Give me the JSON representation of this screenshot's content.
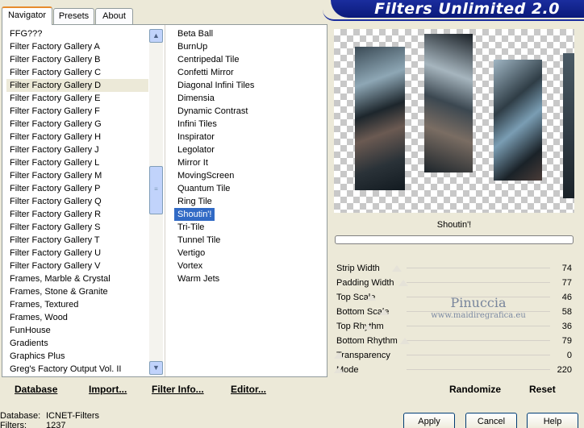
{
  "app": {
    "title": "Filters Unlimited 2.0"
  },
  "tabs": [
    {
      "label": "Navigator",
      "active": true
    },
    {
      "label": "Presets",
      "active": false
    },
    {
      "label": "About",
      "active": false
    }
  ],
  "categories": [
    "FFG???",
    "Filter Factory Gallery A",
    "Filter Factory Gallery B",
    "Filter Factory Gallery C",
    "Filter Factory Gallery D",
    "Filter Factory Gallery E",
    "Filter Factory Gallery F",
    "Filter Factory Gallery G",
    "Filter Factory Gallery H",
    "Filter Factory Gallery J",
    "Filter Factory Gallery L",
    "Filter Factory Gallery M",
    "Filter Factory Gallery P",
    "Filter Factory Gallery Q",
    "Filter Factory Gallery R",
    "Filter Factory Gallery S",
    "Filter Factory Gallery T",
    "Filter Factory Gallery U",
    "Filter Factory Gallery V",
    "Frames, Marble & Crystal",
    "Frames, Stone & Granite",
    "Frames, Textured",
    "Frames, Wood",
    "FunHouse",
    "Gradients",
    "Graphics Plus",
    "Greg's Factory Output Vol. II"
  ],
  "selected_category": "Filter Factory Gallery D",
  "filters": [
    "Beta Ball",
    "BurnUp",
    "Centripedal Tile",
    "Confetti Mirror",
    "Diagonal Infini Tiles",
    "Dimensia",
    "Dynamic Contrast",
    "Infini Tiles",
    "Inspirator",
    "Legolator",
    "Mirror It",
    "MovingScreen",
    "Quantum Tile",
    "Ring Tile",
    "Shoutin'!",
    "Tri-Tile",
    "Tunnel Tile",
    "Vertigo",
    "Vortex",
    "Warm Jets"
  ],
  "selected_filter": "Shoutin'!",
  "preview": {
    "filter_name": "Shoutin'!",
    "watermark": "Pinuccia",
    "watermark_sub": "www.maidiregrafica.eu"
  },
  "params": [
    {
      "label": "Strip Width",
      "value": "74"
    },
    {
      "label": "Padding Width",
      "value": "77"
    },
    {
      "label": "Top Scale",
      "value": "46"
    },
    {
      "label": "Bottom Scale",
      "value": "58"
    },
    {
      "label": "Top Rhythm",
      "value": "36"
    },
    {
      "label": "Bottom Rhythm",
      "value": "79"
    },
    {
      "label": "Transparency",
      "value": "0"
    },
    {
      "label": "Mode",
      "value": "220"
    }
  ],
  "links": {
    "database": "Database",
    "import": "Import...",
    "filter_info": "Filter Info...",
    "editor": "Editor...",
    "randomize": "Randomize",
    "reset": "Reset"
  },
  "status": {
    "database_label": "Database:",
    "database_value": "ICNET-Filters",
    "filters_label": "Filters:",
    "filters_value": "1237"
  },
  "buttons": {
    "apply": "Apply",
    "cancel": "Cancel",
    "help": "Help"
  },
  "colors": {
    "banner": "#1a2d9e",
    "selection": "#316ac5",
    "tab_accent": "#e68b2c"
  }
}
